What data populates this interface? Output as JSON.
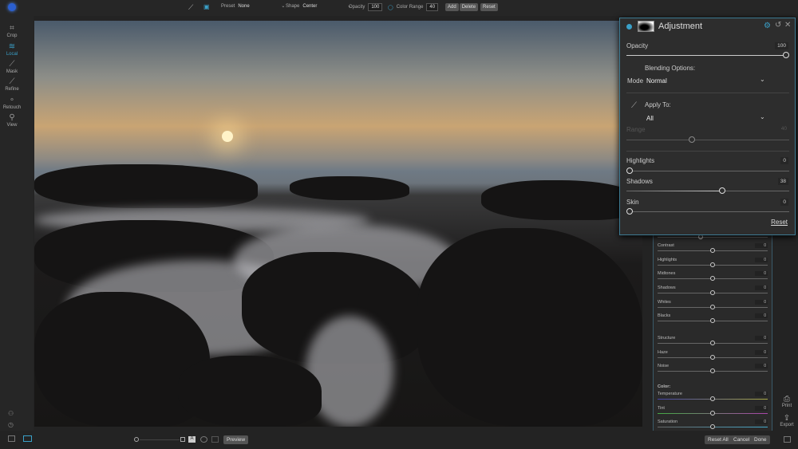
{
  "toolbar": {
    "preset_label": "Preset",
    "preset_value": "None",
    "shape_label": "Shape",
    "shape_value": "Center",
    "opacity_label": "Opacity",
    "opacity_value": "100",
    "color_range_label": "Color Range",
    "color_range_value": "40",
    "add": "Add",
    "delete": "Delete",
    "reset": "Reset"
  },
  "sidebar": {
    "items": [
      {
        "label": "Crop",
        "icon": "crop-icon"
      },
      {
        "label": "Local",
        "icon": "local-icon"
      },
      {
        "label": "Mask",
        "icon": "mask-icon"
      },
      {
        "label": "Refine",
        "icon": "refine-icon"
      },
      {
        "label": "Retouch",
        "icon": "retouch-icon"
      },
      {
        "label": "View",
        "icon": "view-icon"
      }
    ]
  },
  "adjustment": {
    "title": "Adjustment",
    "opacity_label": "Opacity",
    "opacity_value": "100",
    "blending_label": "Blending Options:",
    "mode_label": "Mode",
    "mode_value": "Normal",
    "apply_label": "Apply To:",
    "apply_value": "All",
    "range_label": "Range",
    "range_value": "40",
    "highlights_label": "Highlights",
    "highlights_value": "0",
    "shadows_label": "Shadows",
    "shadows_value": "38",
    "skin_label": "Skin",
    "skin_value": "0",
    "reset": "Reset"
  },
  "panel": {
    "sliders": [
      {
        "label": "Contrast",
        "value": "0"
      },
      {
        "label": "Highlights",
        "value": "0"
      },
      {
        "label": "Midtones",
        "value": "0"
      },
      {
        "label": "Shadows",
        "value": "0"
      },
      {
        "label": "Whites",
        "value": "0"
      },
      {
        "label": "Blacks",
        "value": "0"
      },
      {
        "label": "Structure",
        "value": "0"
      },
      {
        "label": "Haze",
        "value": "0"
      },
      {
        "label": "Noise",
        "value": "0"
      }
    ],
    "color_heading": "Color:",
    "color_sliders": [
      {
        "label": "Temperature",
        "value": "0"
      },
      {
        "label": "Tint",
        "value": "0"
      },
      {
        "label": "Saturation",
        "value": "0"
      }
    ]
  },
  "right_tools": {
    "print": "Print",
    "export": "Export"
  },
  "bottom": {
    "preview": "Preview",
    "reset_all": "Reset All",
    "cancel": "Cancel",
    "done": "Done"
  },
  "colors": {
    "accent": "#3aa0c8"
  }
}
